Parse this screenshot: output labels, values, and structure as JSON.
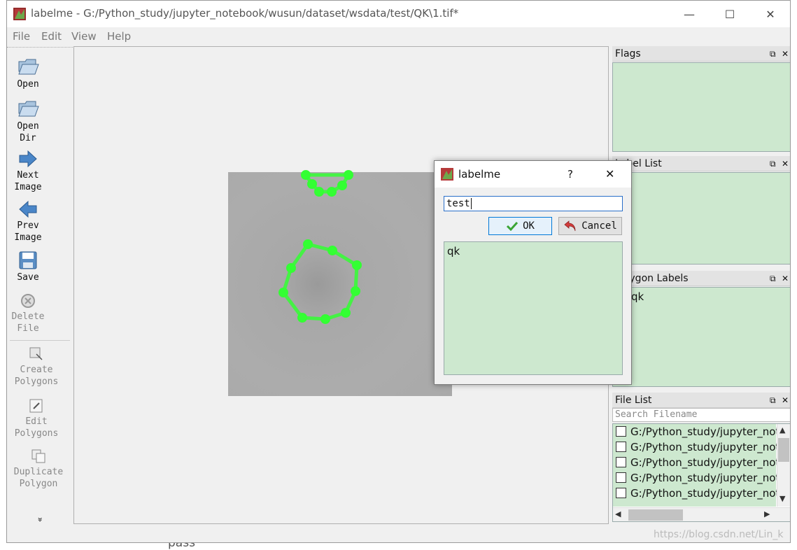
{
  "window": {
    "title": "labelme - G:/Python_study/jupyter_notebook/wusun/dataset/wsdata/test/QK\\1.tif*",
    "minimize_glyph": "—",
    "maximize_glyph": "☐",
    "close_glyph": "✕"
  },
  "menu": [
    "File",
    "Edit",
    "View",
    "Help"
  ],
  "toolbar": {
    "open": "Open",
    "open_dir_1": "Open",
    "open_dir_2": "Dir",
    "next_1": "Next",
    "next_2": "Image",
    "prev_1": "Prev",
    "prev_2": "Image",
    "save": "Save",
    "delete_1": "Delete",
    "delete_2": "File",
    "create_1": "Create",
    "create_2": "Polygons",
    "edit_1": "Edit",
    "edit_2": "Polygons",
    "dup_1": "Duplicate",
    "dup_2": "Polygon",
    "more": "»"
  },
  "docks": {
    "flags": "Flags",
    "label_list": "Label List",
    "polygon_labels": "Polygon Labels",
    "polygon_item": "qk",
    "file_list": "File List",
    "search_placeholder": "Search Filename",
    "files": [
      "G:/Python_study/jupyter_not",
      "G:/Python_study/jupyter_not",
      "G:/Python_study/jupyter_not",
      "G:/Python_study/jupyter_not",
      "G:/Python_study/jupyter_not"
    ]
  },
  "dialog": {
    "title": "labelme",
    "help_glyph": "?",
    "close_glyph": "✕",
    "input_value": "test",
    "ok": "OK",
    "cancel": "Cancel",
    "list_item": "qk"
  },
  "background": {
    "behind_text": "pass",
    "watermark": "https://blog.csdn.net/Lin_k"
  },
  "colors": {
    "polygon": "#33ff33",
    "list_bg": "#cde8cf"
  }
}
